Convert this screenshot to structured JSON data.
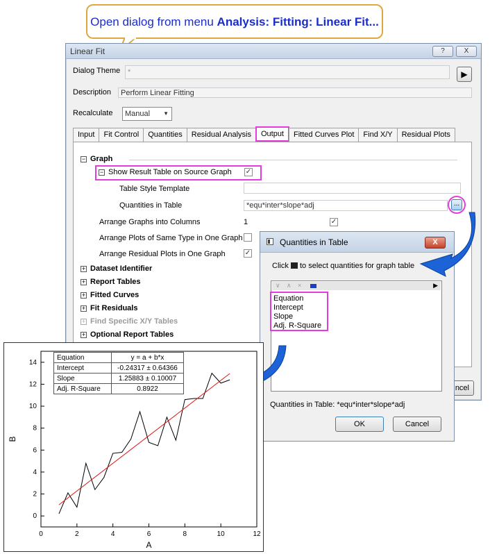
{
  "callout": {
    "text_prefix": "Open dialog from menu ",
    "text_bold": "Analysis: Fitting: Linear Fit..."
  },
  "dialog": {
    "title": "Linear Fit",
    "help_label": "?",
    "close_label": "X",
    "theme_label": "Dialog Theme",
    "theme_value": "*",
    "theme_arrow": "▶",
    "description_label": "Description",
    "description_value": "Perform Linear Fitting",
    "recalculate_label": "Recalculate",
    "recalculate_value": "Manual",
    "tabs": [
      {
        "label": "Input"
      },
      {
        "label": "Fit Control"
      },
      {
        "label": "Quantities"
      },
      {
        "label": "Residual Analysis"
      },
      {
        "label": "Output"
      },
      {
        "label": "Fitted Curves Plot"
      },
      {
        "label": "Find X/Y"
      },
      {
        "label": "Residual Plots"
      }
    ],
    "active_tab": "Output",
    "tree": {
      "graph": "Graph",
      "show_result_table": "Show Result Table on Source Graph",
      "table_style_template": "Table Style Template",
      "quantities_in_table": "Quantities in Table",
      "quantities_value": "*equ*inter*slope*adj",
      "browse": "...",
      "arrange_columns": "Arrange Graphs into Columns",
      "arrange_columns_value": "1",
      "arrange_same_type": "Arrange Plots of Same Type in One Graph",
      "arrange_residual": "Arrange Residual Plots in One Graph",
      "dataset_identifier": "Dataset Identifier",
      "report_tables": "Report Tables",
      "fitted_curves": "Fitted Curves",
      "fit_residuals": "Fit Residuals",
      "find_specific": "Find Specific X/Y Tables",
      "optional_report_tables": "Optional Report Tables"
    },
    "cancel_partial": "ncel"
  },
  "quantities_dialog": {
    "title": "Quantities in Table",
    "close_label": "X",
    "hint_prefix": "Click",
    "hint_suffix": "to select quantities for graph table",
    "items": [
      "Equation",
      "Intercept",
      "Slope",
      "Adj. R-Square"
    ],
    "footer": "Quantities in Table: *equ*inter*slope*adj",
    "ok_label": "OK",
    "cancel_label": "Cancel"
  },
  "colors": {
    "highlight": "#e43cdc",
    "callout_text": "#1a2ccc",
    "callout_border": "#e0a83c",
    "arrow": "#1b63d6",
    "fit_line": "#e01010"
  },
  "chart_data": {
    "type": "line",
    "xlabel": "A",
    "ylabel": "B",
    "xlim": [
      0,
      12
    ],
    "ylim": [
      -1,
      15
    ],
    "xticks": [
      0,
      2,
      4,
      6,
      8,
      10,
      12
    ],
    "yticks": [
      0,
      2,
      4,
      6,
      8,
      10,
      12,
      14
    ],
    "series": [
      {
        "x": [
          1,
          1.5,
          2,
          2.5,
          3,
          3.5,
          4,
          4.5,
          5,
          5.5,
          6,
          6.5,
          7,
          7.5,
          8,
          8.5,
          9,
          9.5,
          10,
          10.5
        ],
        "y": [
          0.2,
          2.1,
          0.8,
          4.8,
          2.4,
          3.5,
          5.7,
          5.8,
          7.0,
          9.5,
          6.7,
          6.4,
          9.0,
          6.9,
          10.6,
          10.7,
          10.7,
          13.0,
          12.1,
          12.4
        ]
      }
    ],
    "fit": {
      "intercept": -0.24317,
      "slope": 1.25883,
      "x_range": [
        1,
        10.5
      ]
    },
    "result_table": [
      {
        "label": "Equation",
        "value": "y = a + b*x"
      },
      {
        "label": "Intercept",
        "value": "-0.24317 ± 0.64366"
      },
      {
        "label": "Slope",
        "value": "1.25883 ± 0.10007"
      },
      {
        "label": "Adj. R-Square",
        "value": "0.8922"
      }
    ],
    "grid": false
  }
}
